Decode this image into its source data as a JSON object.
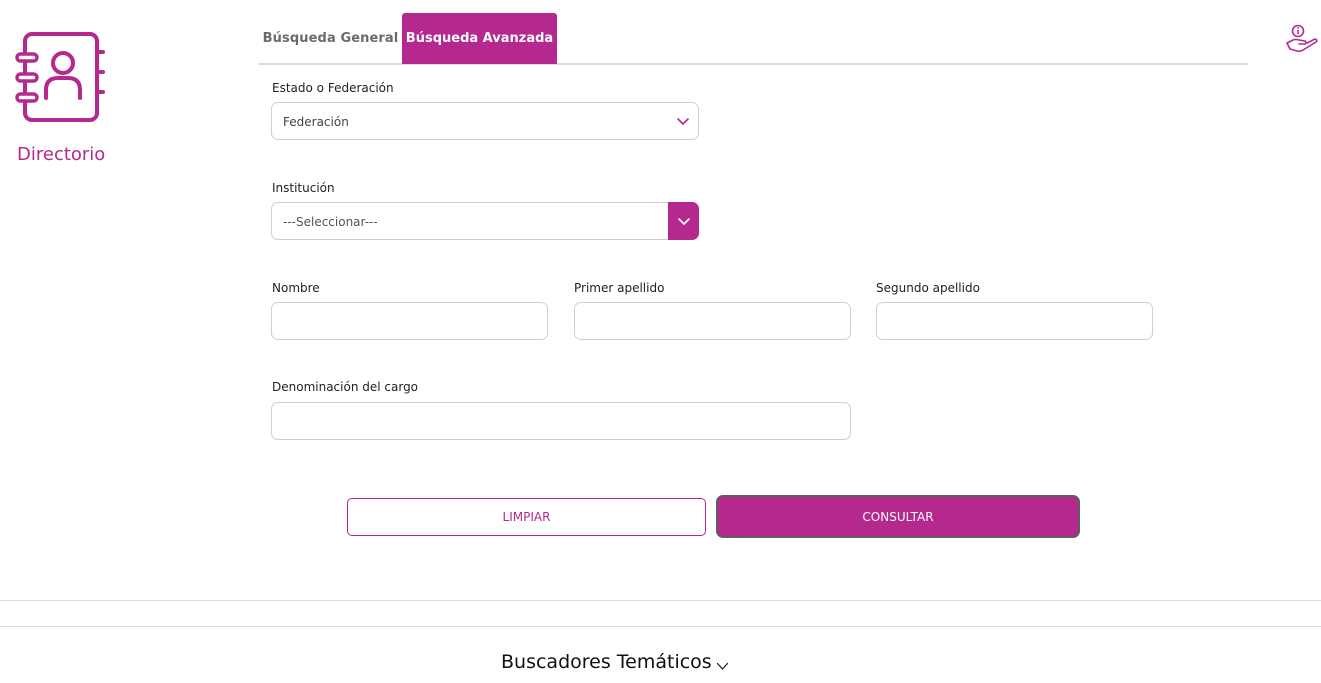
{
  "brand": {
    "label": "Directorio",
    "icon": "address-book-icon"
  },
  "header": {
    "help_icon": "hand-info-icon"
  },
  "tabs": [
    {
      "label": "Búsqueda General",
      "active": false
    },
    {
      "label": "Búsqueda Avanzada",
      "active": true
    }
  ],
  "form": {
    "estado": {
      "label": "Estado o Federación",
      "value": "Federación"
    },
    "institucion": {
      "label": "Institución",
      "value": "---Seleccionar---"
    },
    "nombre": {
      "label": "Nombre",
      "value": ""
    },
    "primer_apellido": {
      "label": "Primer apellido",
      "value": ""
    },
    "segundo_apellido": {
      "label": "Segundo apellido",
      "value": ""
    },
    "cargo": {
      "label": "Denominación del cargo",
      "value": ""
    }
  },
  "buttons": {
    "limpiar": "LIMPIAR",
    "consultar": "CONSULTAR"
  },
  "footer": {
    "thematic_label": "Buscadores Temáticos"
  },
  "colors": {
    "accent": "#b5288d",
    "border": "#cfcfcf",
    "divider": "#dddddd"
  }
}
